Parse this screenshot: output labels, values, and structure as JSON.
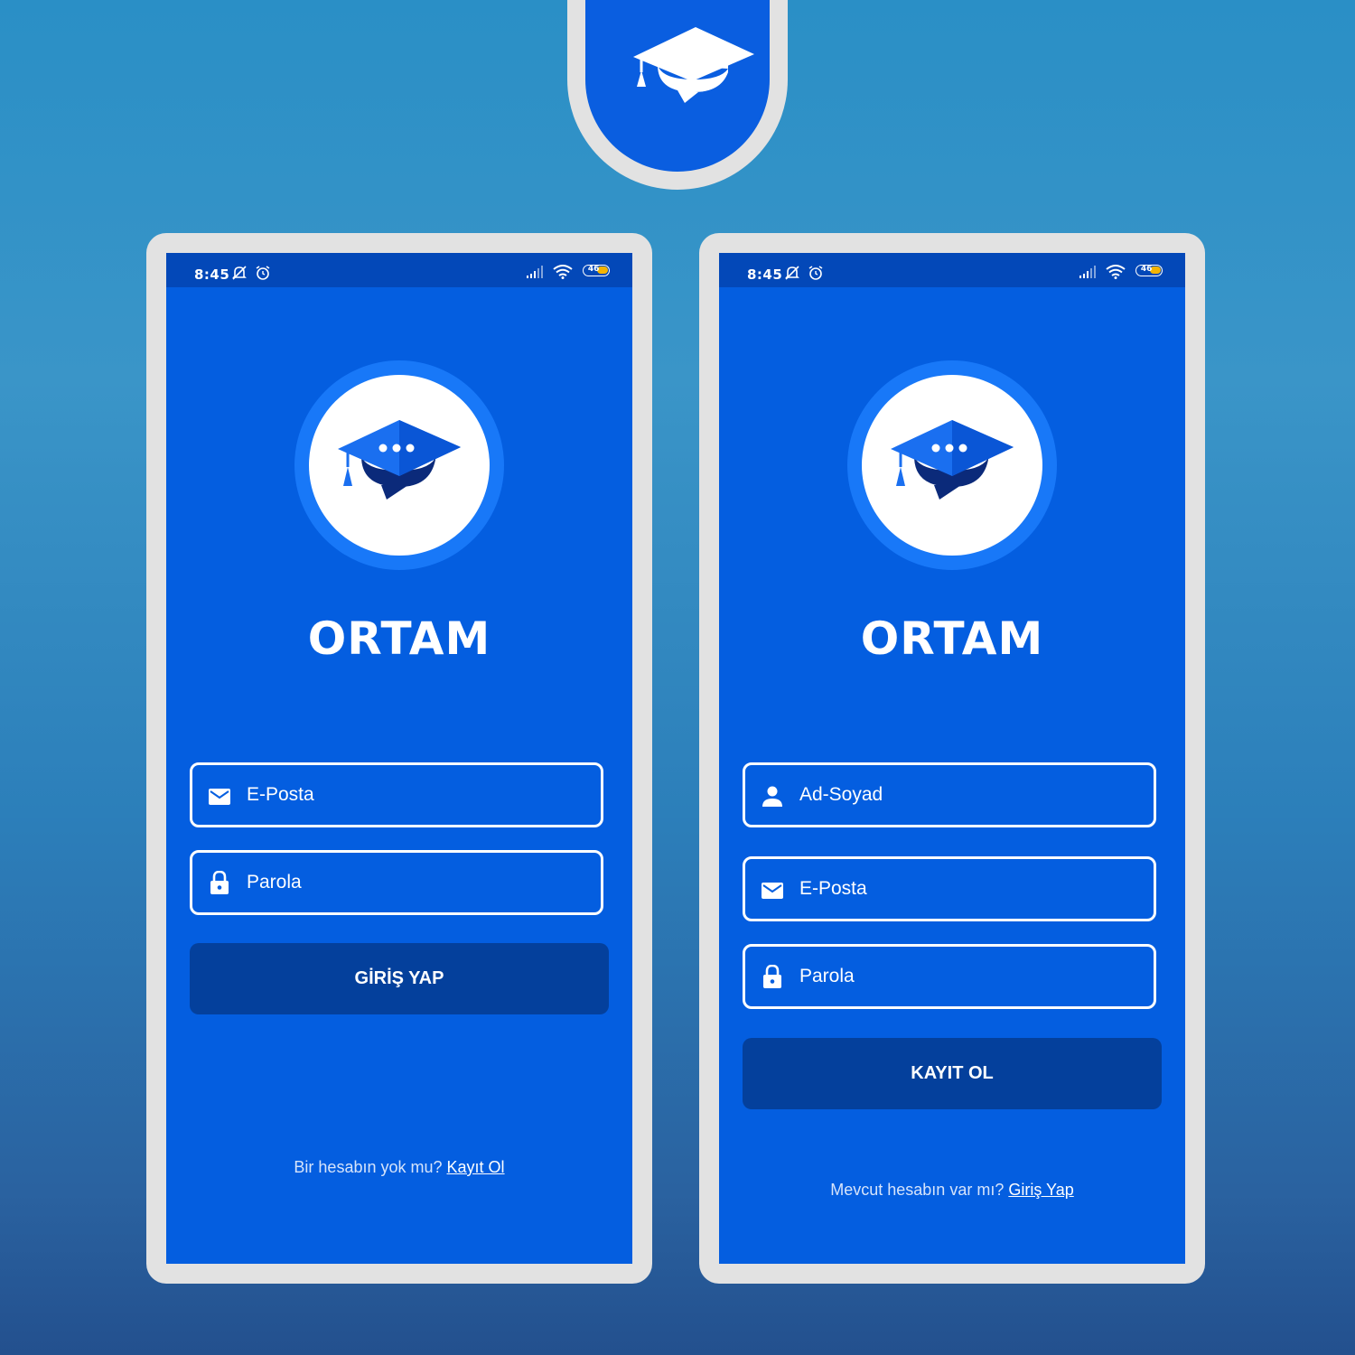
{
  "colors": {
    "background": "#2a8fc6",
    "screen": "#045ee0",
    "statusbar": "#0348b8",
    "button": "#04409c",
    "frame": "#e2e2e2",
    "logo_ring": "#1878f8"
  },
  "login_screen": {
    "status": {
      "time": "8:45",
      "battery": "46"
    },
    "brand": "ORTAM",
    "fields": [
      {
        "icon": "mail-icon",
        "placeholder": "E-Posta"
      },
      {
        "icon": "lock-icon",
        "placeholder": "Parola"
      }
    ],
    "submit_label": "GİRİŞ YAP",
    "footer_prompt": "Bir hesabın yok mu?",
    "footer_link": "Kayıt Ol"
  },
  "register_screen": {
    "status": {
      "time": "8:45",
      "battery": "46"
    },
    "brand": "ORTAM",
    "fields": [
      {
        "icon": "person-icon",
        "placeholder": "Ad-Soyad"
      },
      {
        "icon": "mail-icon",
        "placeholder": "E-Posta"
      },
      {
        "icon": "lock-icon",
        "placeholder": "Parola"
      }
    ],
    "submit_label": "KAYIT OL",
    "footer_prompt": "Mevcut hesabın var mı?",
    "footer_link": "Giriş Yap"
  }
}
